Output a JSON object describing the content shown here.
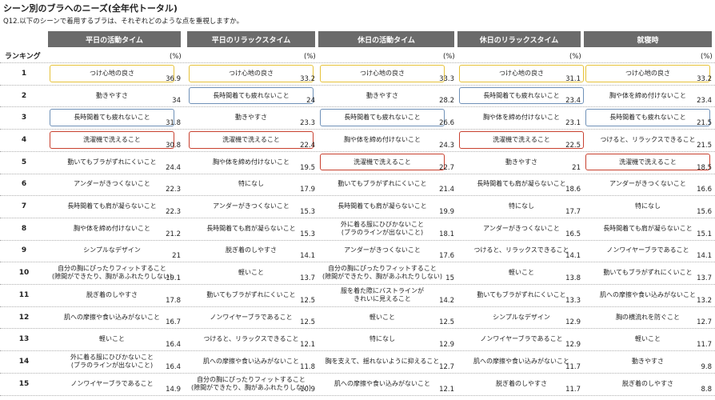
{
  "title": "シーン別のブラへのニーズ(全年代トータル)",
  "subtitle": "Q12.以下のシーンで着用するブラは、それぞれどのような点を重視しますか。",
  "rank_header": "ランキング",
  "unit": "(%)",
  "colors": {
    "header_bg": "#6b6b6b",
    "highlight_yellow": "#e6c23a",
    "highlight_blue": "#6f91b8",
    "highlight_red": "#c8402f"
  },
  "columns": [
    {
      "header": "平日の活動タイム",
      "rows": [
        {
          "text": "つけ心地の良さ",
          "value": "36.9",
          "hl": "yellow"
        },
        {
          "text": "動きやすさ",
          "value": "34",
          "hl": ""
        },
        {
          "text": "長時間着ても疲れないこと",
          "value": "31.8",
          "hl": "blue"
        },
        {
          "text": "洗濯機で洗えること",
          "value": "30.8",
          "hl": "red"
        },
        {
          "text": "動いてもブラがずれにくいこと",
          "value": "24.4",
          "hl": ""
        },
        {
          "text": "アンダーがきつくないこと",
          "value": "22.3",
          "hl": ""
        },
        {
          "text": "長時間着ても肩が凝らないこと",
          "value": "22.3",
          "hl": ""
        },
        {
          "text": "胸や体を締め付けないこと",
          "value": "21.2",
          "hl": ""
        },
        {
          "text": "シンプルなデザイン",
          "value": "21",
          "hl": ""
        },
        {
          "text": "自分の胸にぴったりフィットすること\n(隙間ができたり、胸があふれたりしない)",
          "value": "19.1",
          "hl": ""
        },
        {
          "text": "脱ぎ着のしやすさ",
          "value": "17.8",
          "hl": ""
        },
        {
          "text": "肌への摩擦や食い込みがないこと",
          "value": "16.7",
          "hl": ""
        },
        {
          "text": "軽いこと",
          "value": "16.4",
          "hl": ""
        },
        {
          "text": "外に着る服にひびかないこと\n(ブラのラインが出ないこと)",
          "value": "16.4",
          "hl": ""
        },
        {
          "text": "ノンワイヤーブラであること",
          "value": "14.9",
          "hl": ""
        }
      ]
    },
    {
      "header": "平日のリラックスタイム",
      "rows": [
        {
          "text": "つけ心地の良さ",
          "value": "33.2",
          "hl": "yellow"
        },
        {
          "text": "長時間着ても疲れないこと",
          "value": "24",
          "hl": "blue"
        },
        {
          "text": "動きやすさ",
          "value": "23.3",
          "hl": ""
        },
        {
          "text": "洗濯機で洗えること",
          "value": "22.4",
          "hl": "red"
        },
        {
          "text": "胸や体を締め付けないこと",
          "value": "19.5",
          "hl": ""
        },
        {
          "text": "特になし",
          "value": "17.9",
          "hl": ""
        },
        {
          "text": "アンダーがきつくないこと",
          "value": "15.3",
          "hl": ""
        },
        {
          "text": "長時間着ても肩が凝らないこと",
          "value": "15.3",
          "hl": ""
        },
        {
          "text": "脱ぎ着のしやすさ",
          "value": "14.1",
          "hl": ""
        },
        {
          "text": "軽いこと",
          "value": "13.7",
          "hl": ""
        },
        {
          "text": "動いてもブラがずれにくいこと",
          "value": "12.5",
          "hl": ""
        },
        {
          "text": "ノンワイヤーブラであること",
          "value": "12.5",
          "hl": ""
        },
        {
          "text": "つけると、リラックスできること",
          "value": "12.1",
          "hl": ""
        },
        {
          "text": "肌への摩擦や食い込みがないこと",
          "value": "11.8",
          "hl": ""
        },
        {
          "text": "自分の胸にぴったりフィットすること\n(隙間ができたり、胸があふれたりしない)",
          "value": "10.9",
          "hl": ""
        }
      ]
    },
    {
      "header": "休日の活動タイム",
      "rows": [
        {
          "text": "つけ心地の良さ",
          "value": "33.3",
          "hl": "yellow"
        },
        {
          "text": "動きやすさ",
          "value": "28.2",
          "hl": ""
        },
        {
          "text": "長時間着ても疲れないこと",
          "value": "26.6",
          "hl": "blue"
        },
        {
          "text": "胸や体を締め付けないこと",
          "value": "24.3",
          "hl": ""
        },
        {
          "text": "洗濯機で洗えること",
          "value": "22.7",
          "hl": "red"
        },
        {
          "text": "動いてもブラがずれにくいこと",
          "value": "21.4",
          "hl": ""
        },
        {
          "text": "長時間着ても肩が凝らないこと",
          "value": "19.9",
          "hl": ""
        },
        {
          "text": "外に着る服にひびかないこと\n(ブラのラインが出ないこと)",
          "value": "18.1",
          "hl": ""
        },
        {
          "text": "アンダーがきつくないこと",
          "value": "17.6",
          "hl": ""
        },
        {
          "text": "自分の胸にぴったりフィットすること\n(隙間ができたり、胸があふれたりしない)",
          "value": "15",
          "hl": ""
        },
        {
          "text": "服を着た際にバストラインが\nきれいに見えること",
          "value": "14.2",
          "hl": ""
        },
        {
          "text": "軽いこと",
          "value": "12.5",
          "hl": ""
        },
        {
          "text": "特になし",
          "value": "12.9",
          "hl": ""
        },
        {
          "text": "胸を支えて、揺れないように抑えること",
          "value": "12.7",
          "hl": ""
        },
        {
          "text": "肌への摩擦や食い込みがないこと",
          "value": "12.1",
          "hl": ""
        }
      ]
    },
    {
      "header": "休日のリラックスタイム",
      "rows": [
        {
          "text": "つけ心地の良さ",
          "value": "31.1",
          "hl": "yellow"
        },
        {
          "text": "長時間着ても疲れないこと",
          "value": "23.4",
          "hl": "blue"
        },
        {
          "text": "胸や体を締め付けないこと",
          "value": "23.1",
          "hl": ""
        },
        {
          "text": "洗濯機で洗えること",
          "value": "22.5",
          "hl": "red"
        },
        {
          "text": "動きやすさ",
          "value": "21",
          "hl": ""
        },
        {
          "text": "長時間着ても肩が凝らないこと",
          "value": "18.6",
          "hl": ""
        },
        {
          "text": "特になし",
          "value": "17.7",
          "hl": ""
        },
        {
          "text": "アンダーがきつくないこと",
          "value": "16.5",
          "hl": ""
        },
        {
          "text": "つけると、リラックスできること",
          "value": "14.1",
          "hl": ""
        },
        {
          "text": "軽いこと",
          "value": "13.8",
          "hl": ""
        },
        {
          "text": "動いてもブラがずれにくいこと",
          "value": "13.3",
          "hl": ""
        },
        {
          "text": "シンプルなデザイン",
          "value": "12.9",
          "hl": ""
        },
        {
          "text": "ノンワイヤーブラであること",
          "value": "12.9",
          "hl": ""
        },
        {
          "text": "肌への摩擦や食い込みがないこと",
          "value": "11.7",
          "hl": ""
        },
        {
          "text": "脱ぎ着のしやすさ",
          "value": "11.7",
          "hl": ""
        }
      ]
    },
    {
      "header": "就寝時",
      "rows": [
        {
          "text": "つけ心地の良さ",
          "value": "33.2",
          "hl": "yellow"
        },
        {
          "text": "胸や体を締め付けないこと",
          "value": "23.4",
          "hl": ""
        },
        {
          "text": "長時間着ても疲れないこと",
          "value": "21.5",
          "hl": "blue"
        },
        {
          "text": "つけると、リラックスできること",
          "value": "21.5",
          "hl": ""
        },
        {
          "text": "洗濯機で洗えること",
          "value": "18.5",
          "hl": "red"
        },
        {
          "text": "アンダーがきつくないこと",
          "value": "16.6",
          "hl": ""
        },
        {
          "text": "特になし",
          "value": "15.6",
          "hl": ""
        },
        {
          "text": "長時間着ても肩が凝らないこと",
          "value": "15.1",
          "hl": ""
        },
        {
          "text": "ノンワイヤーブラであること",
          "value": "14.1",
          "hl": ""
        },
        {
          "text": "動いてもブラがずれにくいこと",
          "value": "13.7",
          "hl": ""
        },
        {
          "text": "肌への摩擦や食い込みがないこと",
          "value": "13.2",
          "hl": ""
        },
        {
          "text": "胸の横流れを防ぐこと",
          "value": "12.7",
          "hl": ""
        },
        {
          "text": "軽いこと",
          "value": "11.7",
          "hl": ""
        },
        {
          "text": "動きやすさ",
          "value": "9.8",
          "hl": ""
        },
        {
          "text": "脱ぎ着のしやすさ",
          "value": "8.8",
          "hl": ""
        }
      ]
    }
  ]
}
